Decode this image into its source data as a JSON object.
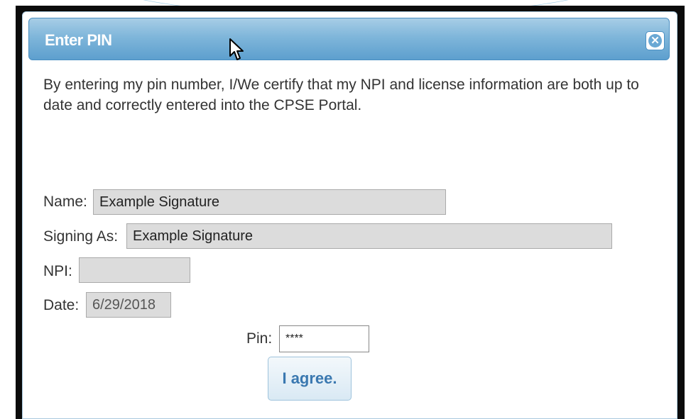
{
  "dialog": {
    "title": "Enter PIN",
    "certification_text": "By entering my pin number, I/We certify that my NPI and license information are both up to date and correctly entered into the CPSE Portal.",
    "close_icon": "close-icon"
  },
  "form": {
    "name_label": "Name:",
    "name_value": "Example Signature",
    "signing_as_label": "Signing As:",
    "signing_as_value": "Example Signature",
    "npi_label": "NPI:",
    "npi_value": "",
    "date_label": "Date:",
    "date_value": "6/29/2018",
    "pin_label": "Pin:",
    "pin_value": "****"
  },
  "actions": {
    "agree_label": "I agree."
  },
  "colors": {
    "titlebar": "#7fb6da",
    "title_text": "#ffffff",
    "button_text": "#3a78b0"
  }
}
